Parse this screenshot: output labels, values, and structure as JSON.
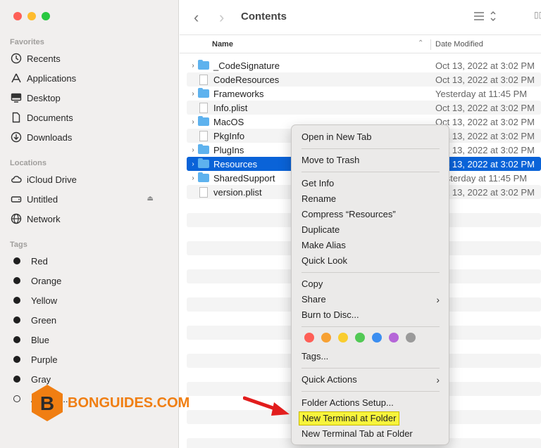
{
  "window": {
    "title": "Contents"
  },
  "sidebar": {
    "favorites_heading": "Favorites",
    "favorites": [
      {
        "label": "Recents",
        "icon": "clock-icon"
      },
      {
        "label": "Applications",
        "icon": "applications-icon"
      },
      {
        "label": "Desktop",
        "icon": "desktop-icon"
      },
      {
        "label": "Documents",
        "icon": "document-icon"
      },
      {
        "label": "Downloads",
        "icon": "download-icon"
      }
    ],
    "locations_heading": "Locations",
    "locations": [
      {
        "label": "iCloud Drive",
        "icon": "cloud-icon"
      },
      {
        "label": "Untitled",
        "icon": "drive-icon"
      },
      {
        "label": "Network",
        "icon": "globe-icon"
      }
    ],
    "tags_heading": "Tags",
    "tags": [
      {
        "label": "Red"
      },
      {
        "label": "Orange"
      },
      {
        "label": "Yellow"
      },
      {
        "label": "Green"
      },
      {
        "label": "Blue"
      },
      {
        "label": "Purple"
      },
      {
        "label": "Gray"
      },
      {
        "label": "All Tags..."
      }
    ]
  },
  "columns": {
    "name": "Name",
    "date": "Date Modified"
  },
  "files": [
    {
      "name": "_CodeSignature",
      "date": "Oct 13, 2022 at 3:02 PM",
      "type": "folder"
    },
    {
      "name": "CodeResources",
      "date": "Oct 13, 2022 at 3:02 PM",
      "type": "file"
    },
    {
      "name": "Frameworks",
      "date": "Yesterday at 11:45 PM",
      "type": "folder"
    },
    {
      "name": "Info.plist",
      "date": "Oct 13, 2022 at 3:02 PM",
      "type": "file"
    },
    {
      "name": "MacOS",
      "date": "Oct 13, 2022 at 3:02 PM",
      "type": "folder"
    },
    {
      "name": "PkgInfo",
      "date": "Oct 13, 2022 at 3:02 PM",
      "type": "file"
    },
    {
      "name": "PlugIns",
      "date": "Oct 13, 2022 at 3:02 PM",
      "type": "folder"
    },
    {
      "name": "Resources",
      "date": "Oct 13, 2022 at 3:02 PM",
      "type": "folder"
    },
    {
      "name": "SharedSupport",
      "date": "Yesterday at 11:45 PM",
      "type": "folder"
    },
    {
      "name": "version.plist",
      "date": "Oct 13, 2022 at 3:02 PM",
      "type": "file"
    }
  ],
  "context_menu": {
    "open_new_tab": "Open in New Tab",
    "move_to_trash": "Move to Trash",
    "get_info": "Get Info",
    "rename": "Rename",
    "compress": "Compress “Resources”",
    "duplicate": "Duplicate",
    "make_alias": "Make Alias",
    "quick_look": "Quick Look",
    "copy": "Copy",
    "share": "Share",
    "burn": "Burn to Disc...",
    "tags": "Tags...",
    "quick_actions": "Quick Actions",
    "folder_actions": "Folder Actions Setup...",
    "new_terminal": "New Terminal at Folder",
    "new_terminal_tab": "New Terminal Tab at Folder",
    "tag_colors": [
      "#fe5f57",
      "#f7a133",
      "#f9cd2e",
      "#52c955",
      "#3b8ef0",
      "#b566d8",
      "#9a9a9a"
    ]
  },
  "watermark": {
    "text": "BONGUIDES.COM",
    "letter": "B"
  }
}
